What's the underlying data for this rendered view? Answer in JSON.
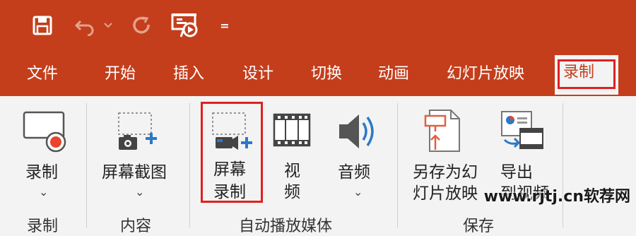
{
  "quick_access": {
    "icons": [
      "save-icon",
      "undo-icon",
      "dropdown-arrow-icon",
      "redo-icon",
      "from-beginning-icon",
      "customize-arrow-icon"
    ],
    "customize_glyph": "="
  },
  "tabs": [
    {
      "label": "文件"
    },
    {
      "label": "开始"
    },
    {
      "label": "插入"
    },
    {
      "label": "设计"
    },
    {
      "label": "切换"
    },
    {
      "label": "动画"
    },
    {
      "label": "幻灯片放映"
    },
    {
      "label": "录制",
      "active": true
    }
  ],
  "ribbon": {
    "record": {
      "line1": "录制",
      "group": "录制"
    },
    "screenshot": {
      "line1": "屏幕截图",
      "group": "内容"
    },
    "screen_recording": {
      "line1": "屏幕",
      "line2": "录制"
    },
    "video": {
      "line1": "视",
      "line2": "频"
    },
    "audio": {
      "line1": "音频"
    },
    "autoplay_group": "自动播放媒体",
    "save_as_show": {
      "line1": "另存为幻",
      "line2": "灯片放映"
    },
    "export_video": {
      "line1": "导出",
      "line2": "到视频"
    },
    "save_group": "保存",
    "dropdown_glyph": "⌄"
  },
  "watermark": "www.rjtj.cn软荐网",
  "colors": {
    "accent": "#c43e1c",
    "highlight": "#e02020",
    "ribbon_bg": "#f3f3f3"
  }
}
